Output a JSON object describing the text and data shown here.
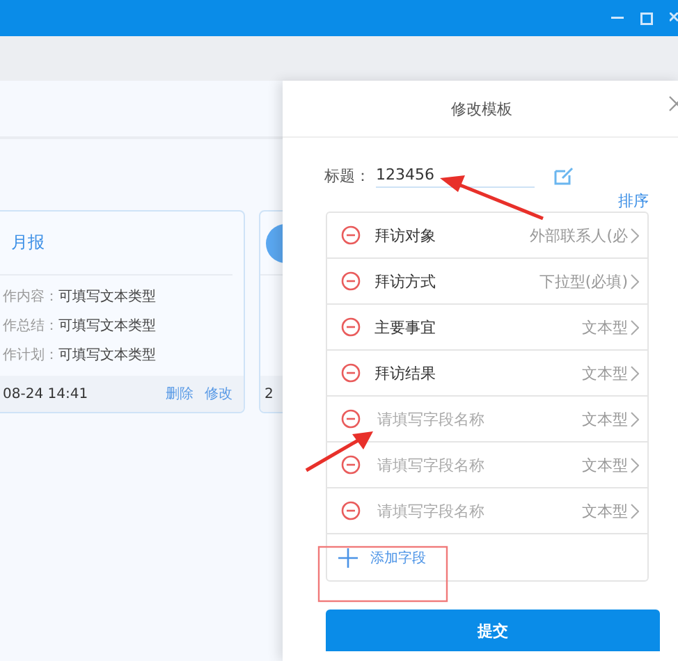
{
  "main": {
    "cards": [
      {
        "title": "月报",
        "rows": [
          {
            "label": "作内容：",
            "value": "可填写文本类型"
          },
          {
            "label": "作总结：",
            "value": "可填写文本类型"
          },
          {
            "label": "作计划：",
            "value": "可填写文本类型"
          }
        ],
        "time": "08-24 14:41",
        "actions": [
          "删除",
          "修改"
        ]
      },
      {
        "time": "2"
      }
    ]
  },
  "panel": {
    "title": "修改模板",
    "title_label": "标题：",
    "title_value": "123456",
    "sort_link": "排序",
    "fields": [
      {
        "name": "拜访对象",
        "type": "外部联系人(必"
      },
      {
        "name": "拜访方式",
        "type": "下拉型(必填)"
      },
      {
        "name": "主要事宜",
        "type": "文本型"
      },
      {
        "name": "拜访结果",
        "type": "文本型"
      },
      {
        "placeholder": "请填写字段名称",
        "type": "文本型"
      },
      {
        "placeholder": "请填写字段名称",
        "type": "文本型"
      },
      {
        "placeholder": "请填写字段名称",
        "type": "文本型"
      }
    ],
    "add_field": "添加字段",
    "submit": "提交"
  }
}
